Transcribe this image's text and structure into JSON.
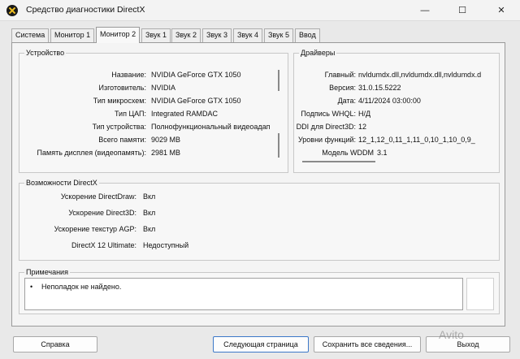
{
  "window": {
    "title": "Средство диагностики DirectX",
    "min_glyph": "—",
    "max_glyph": "☐",
    "close_glyph": "✕"
  },
  "tabs": [
    {
      "label": "Система"
    },
    {
      "label": "Монитор 1"
    },
    {
      "label": "Монитор 2",
      "active": true
    },
    {
      "label": "Звук 1"
    },
    {
      "label": "Звук 2"
    },
    {
      "label": "Звук 3"
    },
    {
      "label": "Звук 4"
    },
    {
      "label": "Звук 5"
    },
    {
      "label": "Ввод"
    }
  ],
  "device": {
    "title": "Устройство",
    "rows": [
      {
        "label": "Название:",
        "value": "NVIDIA GeForce GTX 1050"
      },
      {
        "label": "Изготовитель:",
        "value": "NVIDIA"
      },
      {
        "label": "Тип микросхем:",
        "value": "NVIDIA GeForce GTX 1050"
      },
      {
        "label": "Тип ЦАП:",
        "value": "Integrated RAMDAC"
      },
      {
        "label": "Тип устройства:",
        "value": "Полнофункциональный видеоадап"
      },
      {
        "label": "Всего памяти:",
        "value": "9029 MB"
      },
      {
        "label": "Память дисплея (видеопамять):",
        "value": "2981 MB"
      }
    ]
  },
  "drivers": {
    "title": "Драйверы",
    "rows": [
      {
        "label": "Главный:",
        "value": "nvldumdx.dll,nvldumdx.dll,nvldumdx.d"
      },
      {
        "label": "Версия:",
        "value": "31.0.15.5222"
      },
      {
        "label": "Дата:",
        "value": "4/11/2024 03:00:00"
      },
      {
        "label": "Подпись WHQL:",
        "value": "Н/Д"
      },
      {
        "label": "DDI для Direct3D:",
        "value": "12"
      },
      {
        "label": "Уровни функций:",
        "value": "12_1,12_0,11_1,11_0,10_1,10_0,9_"
      },
      {
        "label": "Модель WDDM",
        "value": "3.1"
      }
    ]
  },
  "directx": {
    "title": "Возможности DirectX",
    "rows": [
      {
        "label": "Ускорение DirectDraw:",
        "value": "Вкл"
      },
      {
        "label": "Ускорение Direct3D:",
        "value": "Вкл"
      },
      {
        "label": "Ускорение текстур AGP:",
        "value": "Вкл"
      },
      {
        "label": "DirectX 12 Ultimate:",
        "value": "Недоступный"
      }
    ]
  },
  "notes": {
    "title": "Примечания",
    "bullet": "•",
    "items": [
      "Неполадок не найдено."
    ]
  },
  "buttons": {
    "help": "Справка",
    "next_page": "Следующая страница",
    "save_all": "Сохранить все сведения...",
    "exit": "Выход"
  },
  "watermark": "Avito"
}
